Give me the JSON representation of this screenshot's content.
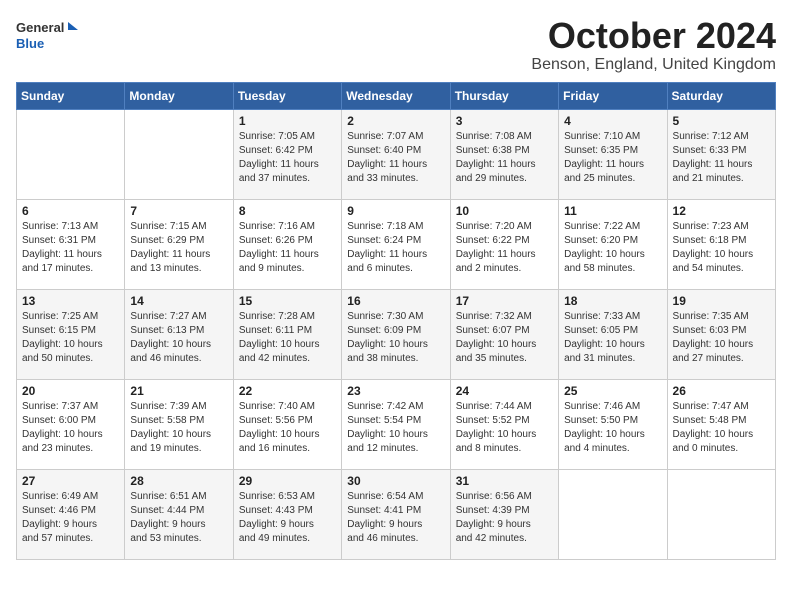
{
  "header": {
    "logo_line1": "General",
    "logo_line2": "Blue",
    "month_title": "October 2024",
    "location": "Benson, England, United Kingdom"
  },
  "days_of_week": [
    "Sunday",
    "Monday",
    "Tuesday",
    "Wednesday",
    "Thursday",
    "Friday",
    "Saturday"
  ],
  "weeks": [
    [
      {
        "day": "",
        "info": ""
      },
      {
        "day": "",
        "info": ""
      },
      {
        "day": "1",
        "info": "Sunrise: 7:05 AM\nSunset: 6:42 PM\nDaylight: 11 hours\nand 37 minutes."
      },
      {
        "day": "2",
        "info": "Sunrise: 7:07 AM\nSunset: 6:40 PM\nDaylight: 11 hours\nand 33 minutes."
      },
      {
        "day": "3",
        "info": "Sunrise: 7:08 AM\nSunset: 6:38 PM\nDaylight: 11 hours\nand 29 minutes."
      },
      {
        "day": "4",
        "info": "Sunrise: 7:10 AM\nSunset: 6:35 PM\nDaylight: 11 hours\nand 25 minutes."
      },
      {
        "day": "5",
        "info": "Sunrise: 7:12 AM\nSunset: 6:33 PM\nDaylight: 11 hours\nand 21 minutes."
      }
    ],
    [
      {
        "day": "6",
        "info": "Sunrise: 7:13 AM\nSunset: 6:31 PM\nDaylight: 11 hours\nand 17 minutes."
      },
      {
        "day": "7",
        "info": "Sunrise: 7:15 AM\nSunset: 6:29 PM\nDaylight: 11 hours\nand 13 minutes."
      },
      {
        "day": "8",
        "info": "Sunrise: 7:16 AM\nSunset: 6:26 PM\nDaylight: 11 hours\nand 9 minutes."
      },
      {
        "day": "9",
        "info": "Sunrise: 7:18 AM\nSunset: 6:24 PM\nDaylight: 11 hours\nand 6 minutes."
      },
      {
        "day": "10",
        "info": "Sunrise: 7:20 AM\nSunset: 6:22 PM\nDaylight: 11 hours\nand 2 minutes."
      },
      {
        "day": "11",
        "info": "Sunrise: 7:22 AM\nSunset: 6:20 PM\nDaylight: 10 hours\nand 58 minutes."
      },
      {
        "day": "12",
        "info": "Sunrise: 7:23 AM\nSunset: 6:18 PM\nDaylight: 10 hours\nand 54 minutes."
      }
    ],
    [
      {
        "day": "13",
        "info": "Sunrise: 7:25 AM\nSunset: 6:15 PM\nDaylight: 10 hours\nand 50 minutes."
      },
      {
        "day": "14",
        "info": "Sunrise: 7:27 AM\nSunset: 6:13 PM\nDaylight: 10 hours\nand 46 minutes."
      },
      {
        "day": "15",
        "info": "Sunrise: 7:28 AM\nSunset: 6:11 PM\nDaylight: 10 hours\nand 42 minutes."
      },
      {
        "day": "16",
        "info": "Sunrise: 7:30 AM\nSunset: 6:09 PM\nDaylight: 10 hours\nand 38 minutes."
      },
      {
        "day": "17",
        "info": "Sunrise: 7:32 AM\nSunset: 6:07 PM\nDaylight: 10 hours\nand 35 minutes."
      },
      {
        "day": "18",
        "info": "Sunrise: 7:33 AM\nSunset: 6:05 PM\nDaylight: 10 hours\nand 31 minutes."
      },
      {
        "day": "19",
        "info": "Sunrise: 7:35 AM\nSunset: 6:03 PM\nDaylight: 10 hours\nand 27 minutes."
      }
    ],
    [
      {
        "day": "20",
        "info": "Sunrise: 7:37 AM\nSunset: 6:00 PM\nDaylight: 10 hours\nand 23 minutes."
      },
      {
        "day": "21",
        "info": "Sunrise: 7:39 AM\nSunset: 5:58 PM\nDaylight: 10 hours\nand 19 minutes."
      },
      {
        "day": "22",
        "info": "Sunrise: 7:40 AM\nSunset: 5:56 PM\nDaylight: 10 hours\nand 16 minutes."
      },
      {
        "day": "23",
        "info": "Sunrise: 7:42 AM\nSunset: 5:54 PM\nDaylight: 10 hours\nand 12 minutes."
      },
      {
        "day": "24",
        "info": "Sunrise: 7:44 AM\nSunset: 5:52 PM\nDaylight: 10 hours\nand 8 minutes."
      },
      {
        "day": "25",
        "info": "Sunrise: 7:46 AM\nSunset: 5:50 PM\nDaylight: 10 hours\nand 4 minutes."
      },
      {
        "day": "26",
        "info": "Sunrise: 7:47 AM\nSunset: 5:48 PM\nDaylight: 10 hours\nand 0 minutes."
      }
    ],
    [
      {
        "day": "27",
        "info": "Sunrise: 6:49 AM\nSunset: 4:46 PM\nDaylight: 9 hours\nand 57 minutes."
      },
      {
        "day": "28",
        "info": "Sunrise: 6:51 AM\nSunset: 4:44 PM\nDaylight: 9 hours\nand 53 minutes."
      },
      {
        "day": "29",
        "info": "Sunrise: 6:53 AM\nSunset: 4:43 PM\nDaylight: 9 hours\nand 49 minutes."
      },
      {
        "day": "30",
        "info": "Sunrise: 6:54 AM\nSunset: 4:41 PM\nDaylight: 9 hours\nand 46 minutes."
      },
      {
        "day": "31",
        "info": "Sunrise: 6:56 AM\nSunset: 4:39 PM\nDaylight: 9 hours\nand 42 minutes."
      },
      {
        "day": "",
        "info": ""
      },
      {
        "day": "",
        "info": ""
      }
    ]
  ]
}
